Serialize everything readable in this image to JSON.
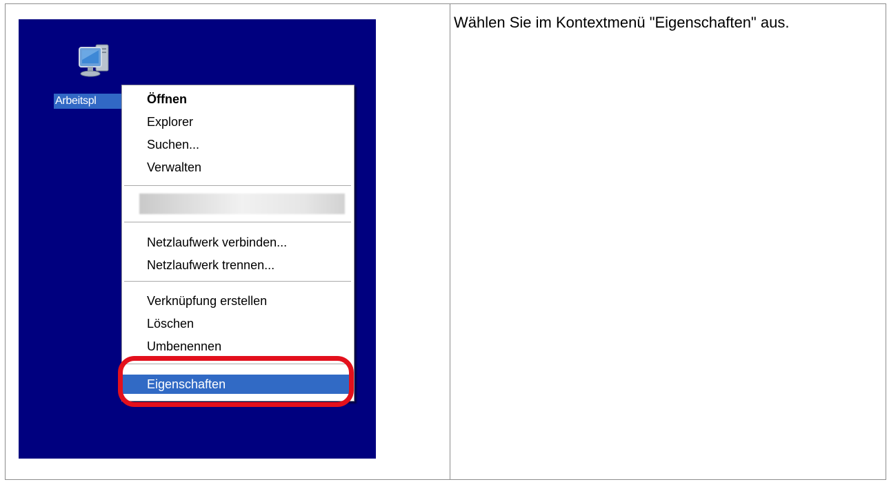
{
  "instruction": {
    "text": "Wählen Sie im Kontextmenü \"Eigenschaften\" aus."
  },
  "desktop": {
    "background_color": "#00007f",
    "icon": {
      "name": "my-computer-icon",
      "label": "Arbeitspl"
    }
  },
  "context_menu": {
    "items": [
      {
        "label": "Öffnen",
        "bold": true
      },
      {
        "label": "Explorer"
      },
      {
        "label": "Suchen..."
      },
      {
        "label": "Verwalten"
      },
      {
        "label": "Netzlaufwerk verbinden..."
      },
      {
        "label": "Netzlaufwerk trennen..."
      },
      {
        "label": "Verknüpfung erstellen"
      },
      {
        "label": "Löschen"
      },
      {
        "label": "Umbenennen"
      },
      {
        "label": "Eigenschaften",
        "selected": true
      }
    ],
    "selection_color": "#316ac5",
    "highlight_color": "#e3101c"
  }
}
